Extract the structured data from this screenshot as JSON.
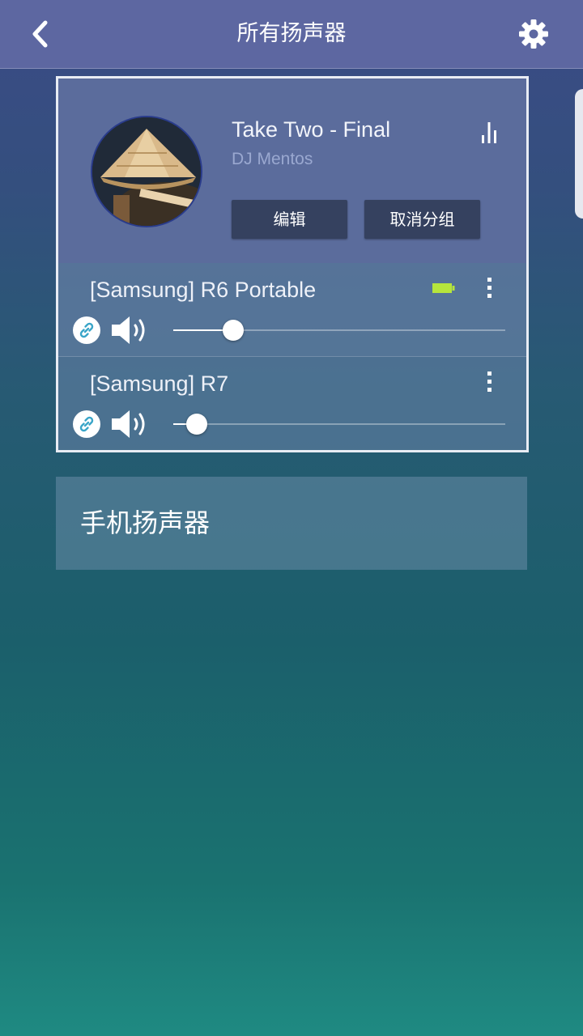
{
  "header": {
    "title": "所有扬声器",
    "back_icon": "chevron-left-icon",
    "settings_icon": "gear-icon"
  },
  "now_playing": {
    "track_title": "Take Two - Final",
    "artist": "DJ Mentos",
    "album_art": "album-art-straw-hat",
    "eq_icon": "equalizer-bars-icon",
    "edit_label": "编辑",
    "ungroup_label": "取消分组"
  },
  "speakers": [
    {
      "name": "[Samsung] R6 Portable",
      "has_battery": true,
      "battery_color": "#b6e53c",
      "volume": 0.18
    },
    {
      "name": "[Samsung] R7",
      "has_battery": false,
      "volume": 0.07
    }
  ],
  "phone_speaker": {
    "label": "手机扬声器"
  },
  "colors": {
    "header_bg": "#5d67a1",
    "button_bg": "#35415f",
    "link_icon_color": "#3aa5c8"
  }
}
